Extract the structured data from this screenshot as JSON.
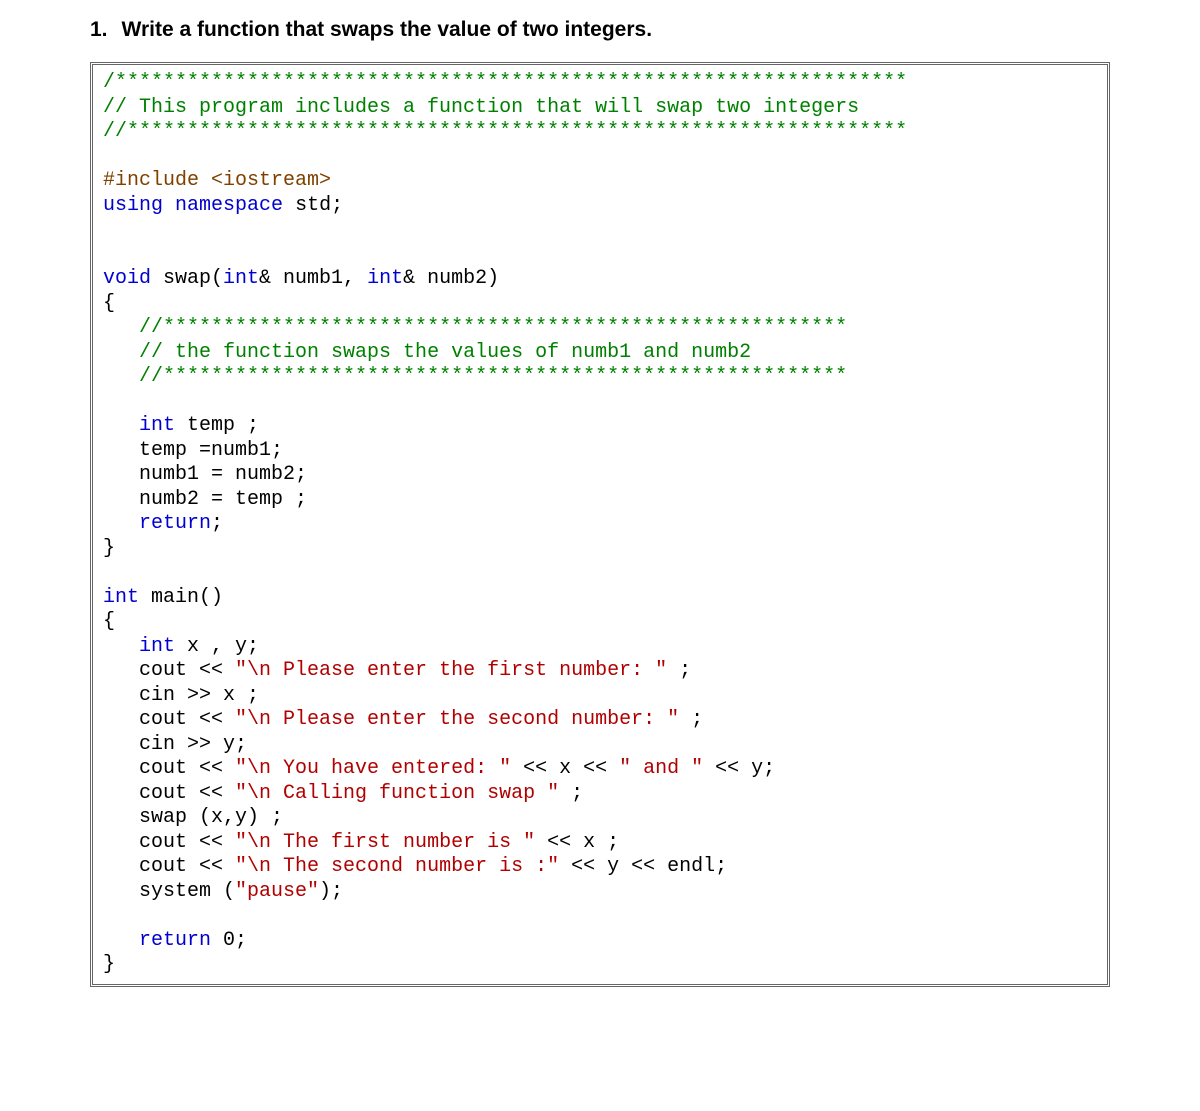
{
  "heading": {
    "number": "1.",
    "text": "Write a function that swaps the value of two integers."
  },
  "code": {
    "tokens": [
      {
        "cls": "c-comment",
        "txt": "/******************************************************************"
      },
      {
        "cls": "",
        "txt": "\n"
      },
      {
        "cls": "c-comment",
        "txt": "// This program includes a function that will swap two integers"
      },
      {
        "cls": "",
        "txt": "\n"
      },
      {
        "cls": "c-comment",
        "txt": "//*****************************************************************"
      },
      {
        "cls": "",
        "txt": "\n"
      },
      {
        "cls": "",
        "txt": "\n"
      },
      {
        "cls": "c-pre",
        "txt": "#include <iostream>"
      },
      {
        "cls": "",
        "txt": "\n"
      },
      {
        "cls": "c-keyword",
        "txt": "using"
      },
      {
        "cls": "",
        "txt": " "
      },
      {
        "cls": "c-keyword",
        "txt": "namespace"
      },
      {
        "cls": "",
        "txt": " std;\n"
      },
      {
        "cls": "",
        "txt": "\n"
      },
      {
        "cls": "",
        "txt": "\n"
      },
      {
        "cls": "c-keyword",
        "txt": "void"
      },
      {
        "cls": "",
        "txt": " swap("
      },
      {
        "cls": "c-keyword",
        "txt": "int"
      },
      {
        "cls": "",
        "txt": "& numb1, "
      },
      {
        "cls": "c-keyword",
        "txt": "int"
      },
      {
        "cls": "",
        "txt": "& numb2)\n"
      },
      {
        "cls": "",
        "txt": "{\n"
      },
      {
        "cls": "",
        "txt": "   "
      },
      {
        "cls": "c-comment",
        "txt": "//*********************************************************"
      },
      {
        "cls": "",
        "txt": "\n"
      },
      {
        "cls": "",
        "txt": "   "
      },
      {
        "cls": "c-comment",
        "txt": "// the function swaps the values of numb1 and numb2"
      },
      {
        "cls": "",
        "txt": "\n"
      },
      {
        "cls": "",
        "txt": "   "
      },
      {
        "cls": "c-comment",
        "txt": "//*********************************************************"
      },
      {
        "cls": "",
        "txt": "\n"
      },
      {
        "cls": "",
        "txt": "\n"
      },
      {
        "cls": "",
        "txt": "   "
      },
      {
        "cls": "c-keyword",
        "txt": "int"
      },
      {
        "cls": "",
        "txt": " temp ;\n"
      },
      {
        "cls": "",
        "txt": "   temp =numb1;\n"
      },
      {
        "cls": "",
        "txt": "   numb1 = numb2;\n"
      },
      {
        "cls": "",
        "txt": "   numb2 = temp ;\n"
      },
      {
        "cls": "",
        "txt": "   "
      },
      {
        "cls": "c-keyword",
        "txt": "return"
      },
      {
        "cls": "",
        "txt": ";\n"
      },
      {
        "cls": "",
        "txt": "}\n"
      },
      {
        "cls": "",
        "txt": "\n"
      },
      {
        "cls": "c-keyword",
        "txt": "int"
      },
      {
        "cls": "",
        "txt": " main()\n"
      },
      {
        "cls": "",
        "txt": "{\n"
      },
      {
        "cls": "",
        "txt": "   "
      },
      {
        "cls": "c-keyword",
        "txt": "int"
      },
      {
        "cls": "",
        "txt": " x , y;\n"
      },
      {
        "cls": "",
        "txt": "   cout << "
      },
      {
        "cls": "c-string",
        "txt": "\"\\n Please enter the first number: \""
      },
      {
        "cls": "",
        "txt": " ;\n"
      },
      {
        "cls": "",
        "txt": "   cin >> x ;\n"
      },
      {
        "cls": "",
        "txt": "   cout << "
      },
      {
        "cls": "c-string",
        "txt": "\"\\n Please enter the second number: \""
      },
      {
        "cls": "",
        "txt": " ;\n"
      },
      {
        "cls": "",
        "txt": "   cin >> y;\n"
      },
      {
        "cls": "",
        "txt": "   cout << "
      },
      {
        "cls": "c-string",
        "txt": "\"\\n You have entered: \""
      },
      {
        "cls": "",
        "txt": " << x << "
      },
      {
        "cls": "c-string",
        "txt": "\" and \""
      },
      {
        "cls": "",
        "txt": " << y;\n"
      },
      {
        "cls": "",
        "txt": "   cout << "
      },
      {
        "cls": "c-string",
        "txt": "\"\\n Calling function swap \""
      },
      {
        "cls": "",
        "txt": " ;\n"
      },
      {
        "cls": "",
        "txt": "   swap (x,y) ;\n"
      },
      {
        "cls": "",
        "txt": "   cout << "
      },
      {
        "cls": "c-string",
        "txt": "\"\\n The first number is \""
      },
      {
        "cls": "",
        "txt": " << x ;\n"
      },
      {
        "cls": "",
        "txt": "   cout << "
      },
      {
        "cls": "c-string",
        "txt": "\"\\n The second number is :\""
      },
      {
        "cls": "",
        "txt": " << y << endl;\n"
      },
      {
        "cls": "",
        "txt": "   system ("
      },
      {
        "cls": "c-string",
        "txt": "\"pause\""
      },
      {
        "cls": "",
        "txt": ");\n"
      },
      {
        "cls": "",
        "txt": "\n"
      },
      {
        "cls": "",
        "txt": "   "
      },
      {
        "cls": "c-keyword",
        "txt": "return"
      },
      {
        "cls": "",
        "txt": " 0;\n"
      },
      {
        "cls": "",
        "txt": "}"
      }
    ]
  }
}
